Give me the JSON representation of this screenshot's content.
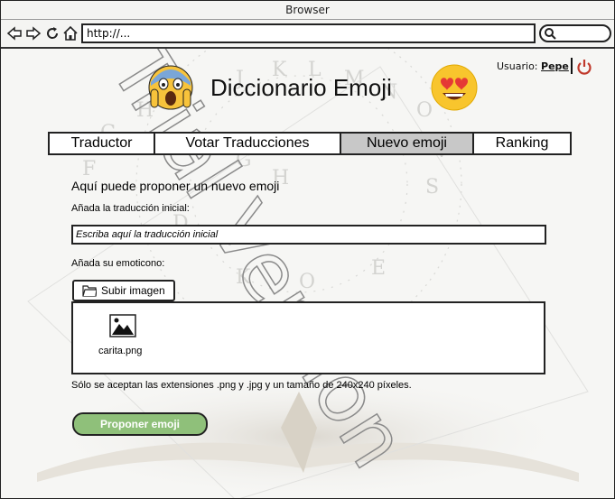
{
  "browser": {
    "title": "Browser",
    "url": "http://..."
  },
  "header": {
    "app_title": "Diccionario Emoji",
    "user_label": "Usuario:",
    "user_name": "Pepe"
  },
  "tabs": [
    {
      "label": "Traductor",
      "active": false
    },
    {
      "label": "Votar Traducciones",
      "active": false
    },
    {
      "label": "Nuevo emoji",
      "active": true
    },
    {
      "label": "Ranking",
      "active": false
    }
  ],
  "form": {
    "heading": "Aquí puede proponer un nuevo emoji",
    "translation_label": "Añada la traducción inicial:",
    "translation_placeholder": "Escriba aquí la traducción inicial",
    "emoticon_label": "Añada su emoticono:",
    "upload_button": "Subir imagen",
    "file_name": "carita.png",
    "note": "Sólo se aceptan las extensiones .png y .jpg y un tamaño de 240x240 píxeles.",
    "submit_button": "Proponer emoji"
  },
  "watermark": "Trial Version",
  "colors": {
    "submit_bg": "#8fc07a",
    "power_icon": "#c0392b",
    "active_tab": "#c8c8c8"
  }
}
